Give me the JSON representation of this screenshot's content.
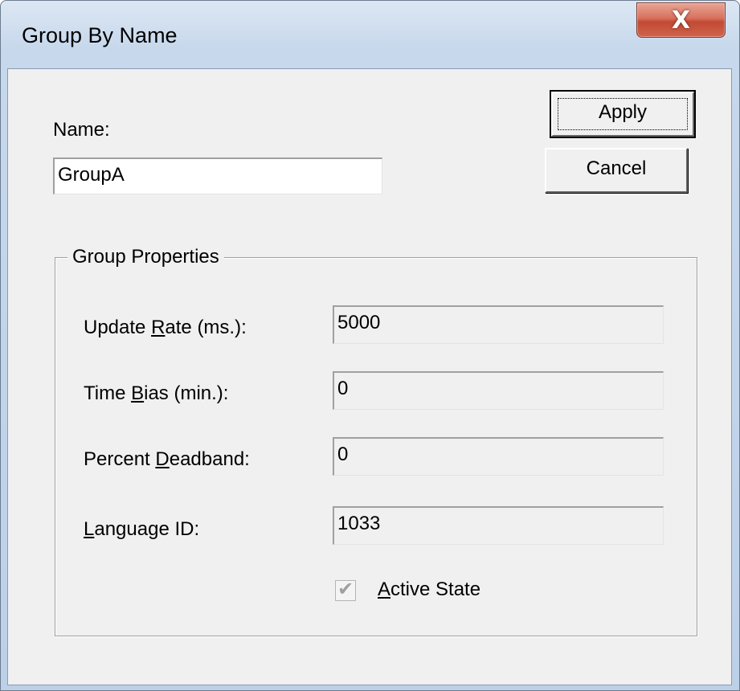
{
  "window": {
    "title": "Group By Name",
    "close_glyph": "X"
  },
  "name_field": {
    "label": "Name:",
    "value": "GroupA"
  },
  "buttons": {
    "apply": "Apply",
    "cancel": "Cancel"
  },
  "group_properties": {
    "title": "Group Properties",
    "update_rate": {
      "label_pre": "Update ",
      "label_mnemonic": "R",
      "label_post": "ate (ms.):",
      "value": "5000"
    },
    "time_bias": {
      "label_pre": "Time ",
      "label_mnemonic": "B",
      "label_post": "ias (min.):",
      "value": "0"
    },
    "percent_deadband": {
      "label_pre": "Percent ",
      "label_mnemonic": "D",
      "label_post": "eadband:",
      "value": "0"
    },
    "language_id": {
      "label_pre": "",
      "label_mnemonic": "L",
      "label_post": "anguage ID:",
      "value": "1033"
    },
    "active_state": {
      "label_mnemonic": "A",
      "label_post": "ctive State",
      "checked": true,
      "disabled": true
    }
  },
  "icons": {
    "checkmark_glyph": "✔"
  },
  "colors": {
    "close_button": "#c24a33",
    "dialog_face": "#f0f0f0",
    "frame": "#c7d8ec"
  }
}
